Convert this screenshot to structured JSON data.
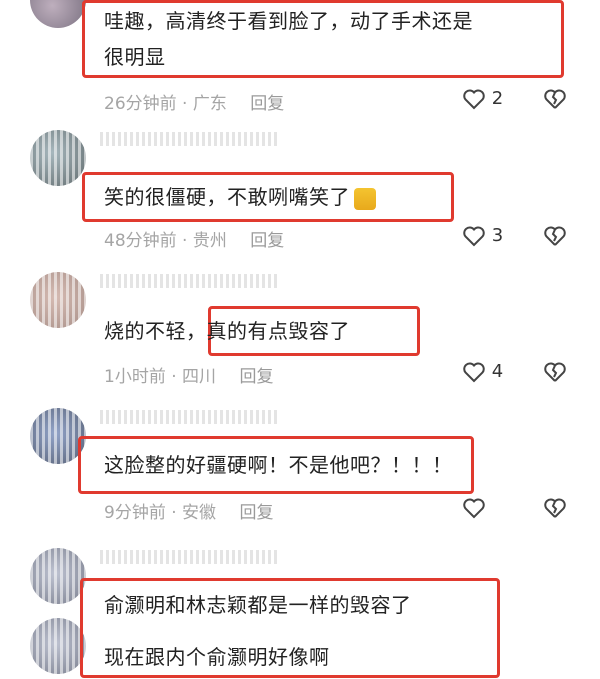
{
  "comments": [
    {
      "lines": [
        "哇趣，高清终于看到脸了，动了手术还是",
        "很明显"
      ],
      "time": "26分钟前",
      "location": "广东",
      "reply": "回复",
      "likes": "2"
    },
    {
      "lines": [
        "笑的很僵硬，不敢咧嘴笑了"
      ],
      "time": "48分钟前",
      "location": "贵州",
      "reply": "回复",
      "likes": "3",
      "emoji": "cat-emoji"
    },
    {
      "lines": [
        "烧的不轻，真的有点毁容了"
      ],
      "time": "1小时前",
      "location": "四川",
      "reply": "回复",
      "likes": "4"
    },
    {
      "lines": [
        "这脸整的好疆硬啊！不是他吧？！！！"
      ],
      "time": "9分钟前",
      "location": "安徽",
      "reply": "回复",
      "likes": ""
    },
    {
      "lines": [
        "俞灏明和林志颖都是一样的毁容了",
        "现在跟内个俞灏明好像啊"
      ]
    }
  ],
  "separator": "·",
  "icons": {
    "like": "heart-outline-icon",
    "dislike": "broken-heart-icon"
  },
  "colors": {
    "highlight_border": "#e03a2f",
    "meta_text": "#a5a5a5"
  }
}
